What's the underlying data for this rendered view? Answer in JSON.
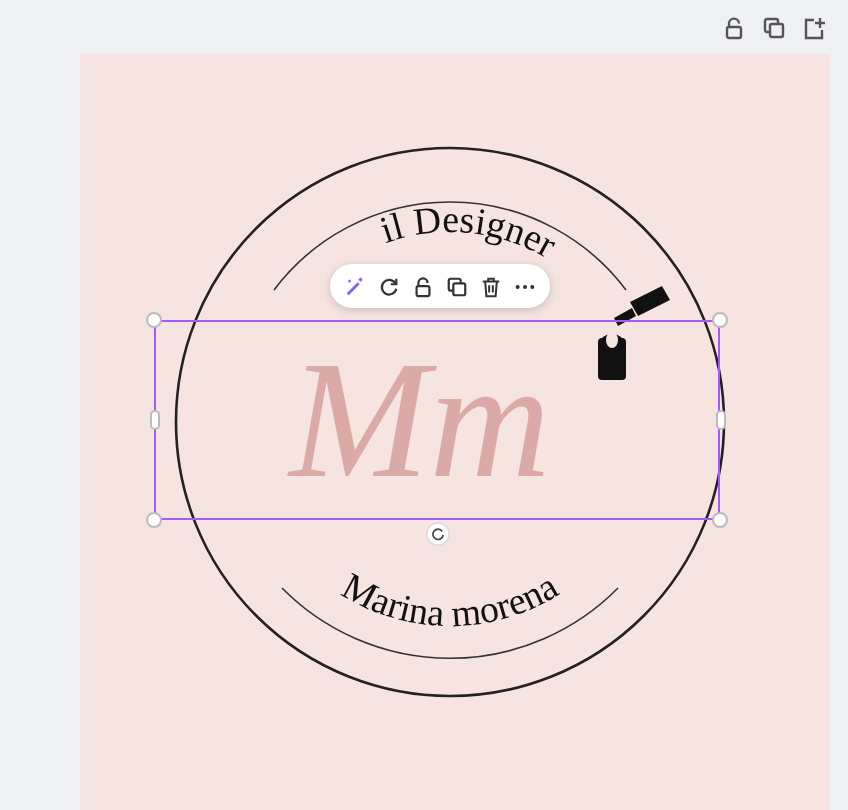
{
  "design": {
    "top_text": "il Designer",
    "monogram": "Mm",
    "bottom_text": "Marina morena",
    "selected": true
  }
}
